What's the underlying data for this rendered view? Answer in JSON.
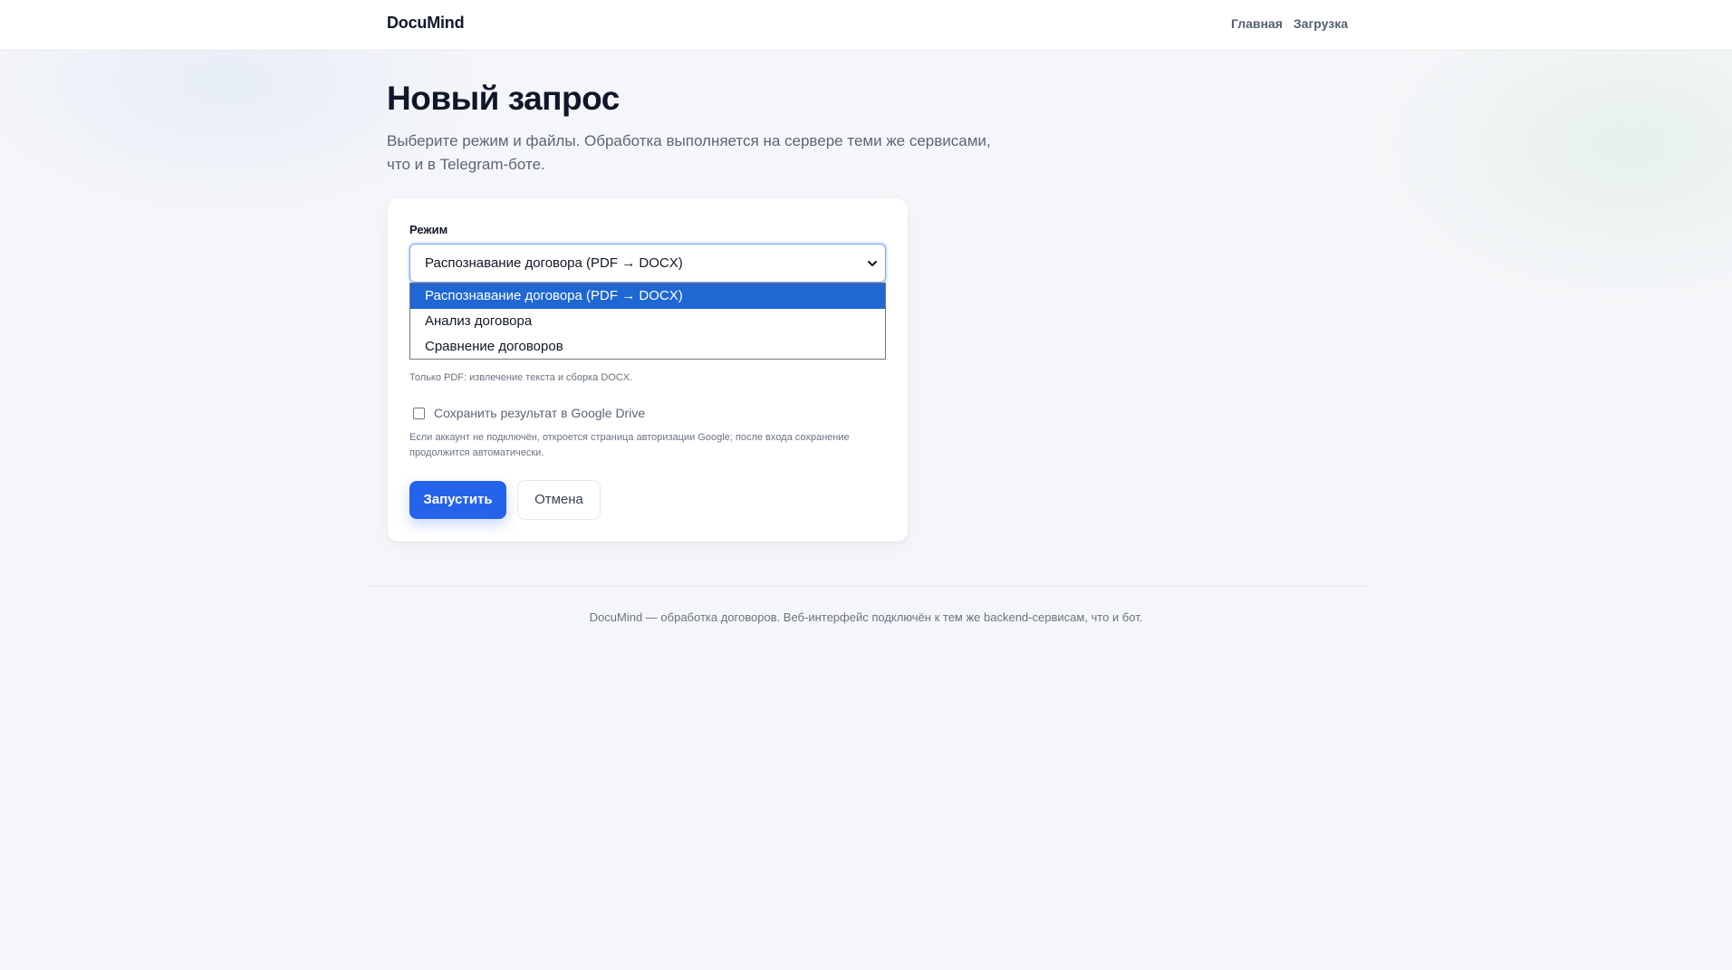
{
  "header": {
    "brand": "DocuMind",
    "nav": [
      "Главная",
      "Загрузка"
    ]
  },
  "page": {
    "title": "Новый запрос",
    "description": "Выберите режим и файлы. Обработка выполняется на сервере теми же сервисами, что и в Telegram-боте."
  },
  "form": {
    "mode_label": "Режим",
    "mode_value": "Распознавание договора (PDF → DOCX)",
    "mode_options": [
      "Распознавание договора (PDF → DOCX)",
      "Анализ договора",
      "Сравнение договоров"
    ],
    "hint": "Только PDF: извлечение текста и сборка DOCX.",
    "save_checkbox_label": "Сохранить результат в Google Drive",
    "save_checkbox_checked": false,
    "note": "Если аккаунт не подключён, откроется страница авторизации Google; после входа сохранение продолжится автоматически.",
    "submit_label": "Запустить",
    "cancel_label": "Отмена"
  },
  "footer": {
    "text": "DocuMind — обработка договоров. Веб-интерфейс подключён к тем же backend-сервисам, что и бот."
  },
  "colors": {
    "accent": "#2563eb",
    "option_highlight": "#1f67d2",
    "background": "#f5f6f9"
  }
}
